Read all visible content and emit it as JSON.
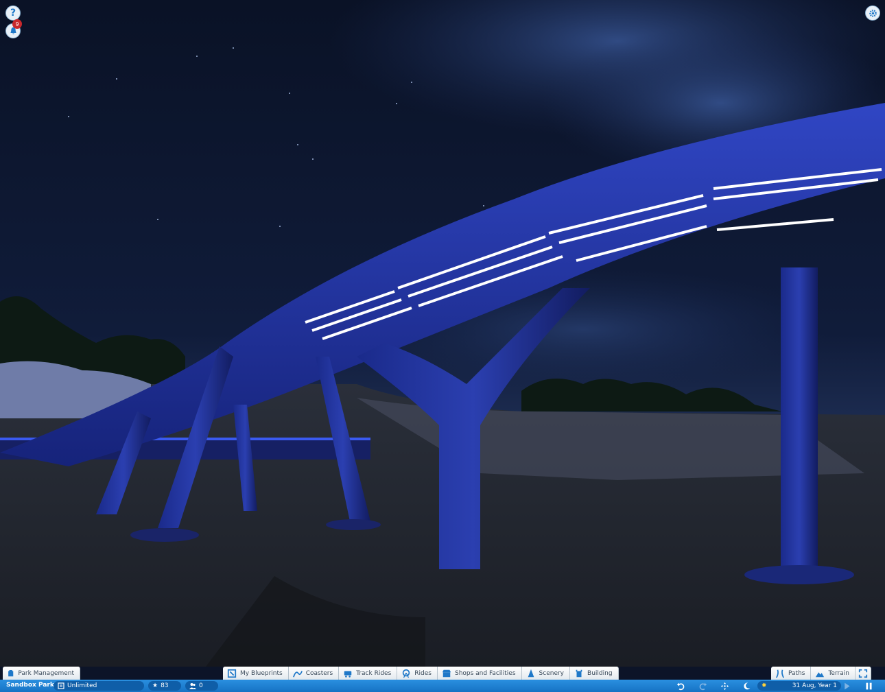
{
  "hud": {
    "help_glyph": "?",
    "notification_count": "9",
    "settings_icon": "gear-icon"
  },
  "bottom_toolbar": {
    "left_tab": "Park Management",
    "center_tabs": [
      "My Blueprints",
      "Coasters",
      "Track Rides",
      "Rides",
      "Shops and Facilities",
      "Scenery",
      "Building"
    ],
    "right_tabs": [
      "Paths",
      "Terrain"
    ]
  },
  "status_bar": {
    "park_name": "Sandbox Park",
    "money": "Unlimited",
    "rating": "83",
    "guests": "0",
    "date": "31 Aug, Year 1"
  },
  "colors": {
    "ui_blue": "#1a7bd0",
    "tab_bg": "#f2f5f8",
    "night_sky": "#0c1428",
    "track_blue": "#2236a8"
  }
}
